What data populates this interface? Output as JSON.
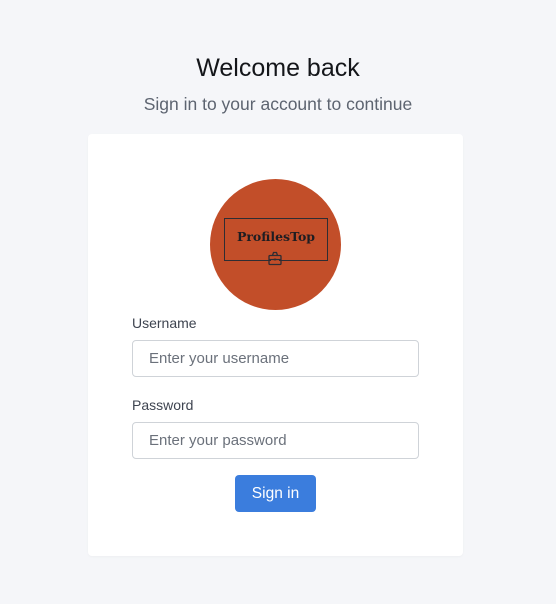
{
  "header": {
    "title": "Welcome back",
    "subtitle": "Sign in to your account to continue"
  },
  "logo": {
    "text": "ProfilesTop",
    "background_color": "#c24e29"
  },
  "form": {
    "username": {
      "label": "Username",
      "placeholder": "Enter your username",
      "value": ""
    },
    "password": {
      "label": "Password",
      "placeholder": "Enter your password",
      "value": ""
    },
    "submit_label": "Sign in"
  },
  "colors": {
    "background": "#f5f6f9",
    "card": "#ffffff",
    "accent": "#3b7ddd"
  }
}
